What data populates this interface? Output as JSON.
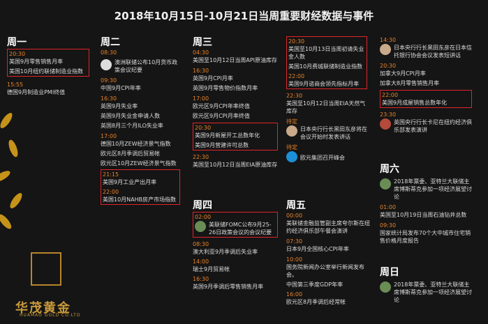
{
  "title": "2018年10月15日-10月21日当周重要财经数据与事件",
  "brand": {
    "name": "华茂黄金",
    "sub": "HUAMAO GOLD CO.LTD"
  },
  "mon": {
    "day": "周一",
    "e1t": "20:30",
    "e1a": "美国9月零售销售月率",
    "e1b": "美国10月纽约联储制造业指数",
    "e2t": "15:55",
    "e2a": "德国9月制造业PMI终值"
  },
  "tue": {
    "day": "周二",
    "a1t": "08:30",
    "a1": "澳洲联储公布10月货币政策会议纪要",
    "a2t": "09:30",
    "a2": "中国9月CPI年率",
    "a3t": "16:30",
    "a3a": "英国9月失业率",
    "a3b": "英国9月失业金申请人数",
    "a3c": "英国8月三个月ILO失业率",
    "a4t": "17:00",
    "a4a": "德国10月ZEW经济景气指数",
    "a4b": "欧元区8月季调后贸易帐",
    "a4c": "欧元区10月ZEW经济景气指数",
    "b1t": "21:15",
    "b1a": "美国9月工业产出月率",
    "b2t": "22:00",
    "b2a": "美国10月NAHB房产市场指数"
  },
  "wed": {
    "day": "周三",
    "a1t": "04:30",
    "a1": "美国至10月12日当周API原油库存",
    "a2t": "16:30",
    "a2": "英国9月CPI月率",
    "a2b": "英国9月零售物价指数月率",
    "a3t": "17:00",
    "a3": "欧元区9月CPI年率终值",
    "a3b": "欧元区9月CPI月率终值",
    "b1t": "20:30",
    "b1a": "美国9月新屋开工总数年化",
    "b1b": "美国9月营建许可总数",
    "a4t": "22:30",
    "a4": "美国至10月12日当周EIA原油库存"
  },
  "thu": {
    "day": "周四",
    "b1t": "02:00",
    "b1": "美联储FOMC公布9月25-26日政策会议的会议纪要",
    "a1t": "08:30",
    "a1": "澳大利亚9月季调后失业率",
    "a2t": "14:00",
    "a2": "瑞士9月贸易帐",
    "a3t": "16:30",
    "a3": "英国9月季调后零售销售月率"
  },
  "thu2": {
    "b1t": "20:30",
    "b1a": "美国至10月13日当周初请失业金人数",
    "b1b": "美国10月费城联储制造业指数",
    "b2t": "22:00",
    "b2a": "美国9月谘商会领先指标月率",
    "a1t": "22:30",
    "a1": "美国至10月12日当周EIA天然气库存",
    "a2t": "待定",
    "a2": "日本央行行长黑田东彦将在会议开始时发表讲话",
    "a3t": "待定",
    "a3": "欧元集团召开峰会"
  },
  "fri": {
    "day": "周五",
    "a1t": "00:00",
    "a1": "美联储金融监管副主席夸尔斯在纽约经济俱乐部午餐会演讲",
    "a2t": "07:30",
    "a2": "日本9月全国核心CPI年率",
    "a3t": "10:00",
    "a3": "国务院新闻办公室举行新闻发布会。",
    "a3b": "中国第三季度GDP年率",
    "a4t": "16:00",
    "a4": "欧元区8月季调后经常帐"
  },
  "fri2": {
    "a1t": "14:30",
    "a1": "日本央行行长黑田东彦在日本信托银行协会会议发表短讲话",
    "a2t": "20:30",
    "a2": "加拿大9月CPI月率",
    "a2b": "加拿大8月零售销售月率",
    "b1t": "22:00",
    "b1": "美国9月成屋销售总数年化",
    "a3t": "23:30",
    "a3": "英国央行行长卡尼在纽约经济俱乐部发表演讲"
  },
  "sat": {
    "day": "周六",
    "a1": "2018年票委、亚特兰大联储主席博斯蒂克参加一项经济展望讨论",
    "a2t": "01:00",
    "a2": "美国至10月19日当周石油钻井总数",
    "a3t": "09:30",
    "a3": "国家统计局发布70个大中城市住宅销售价格月度报告"
  },
  "sun": {
    "day": "周日",
    "a1": "2018年票委、亚特兰大联储主席博斯蒂克参加一项经济展望讨论"
  }
}
